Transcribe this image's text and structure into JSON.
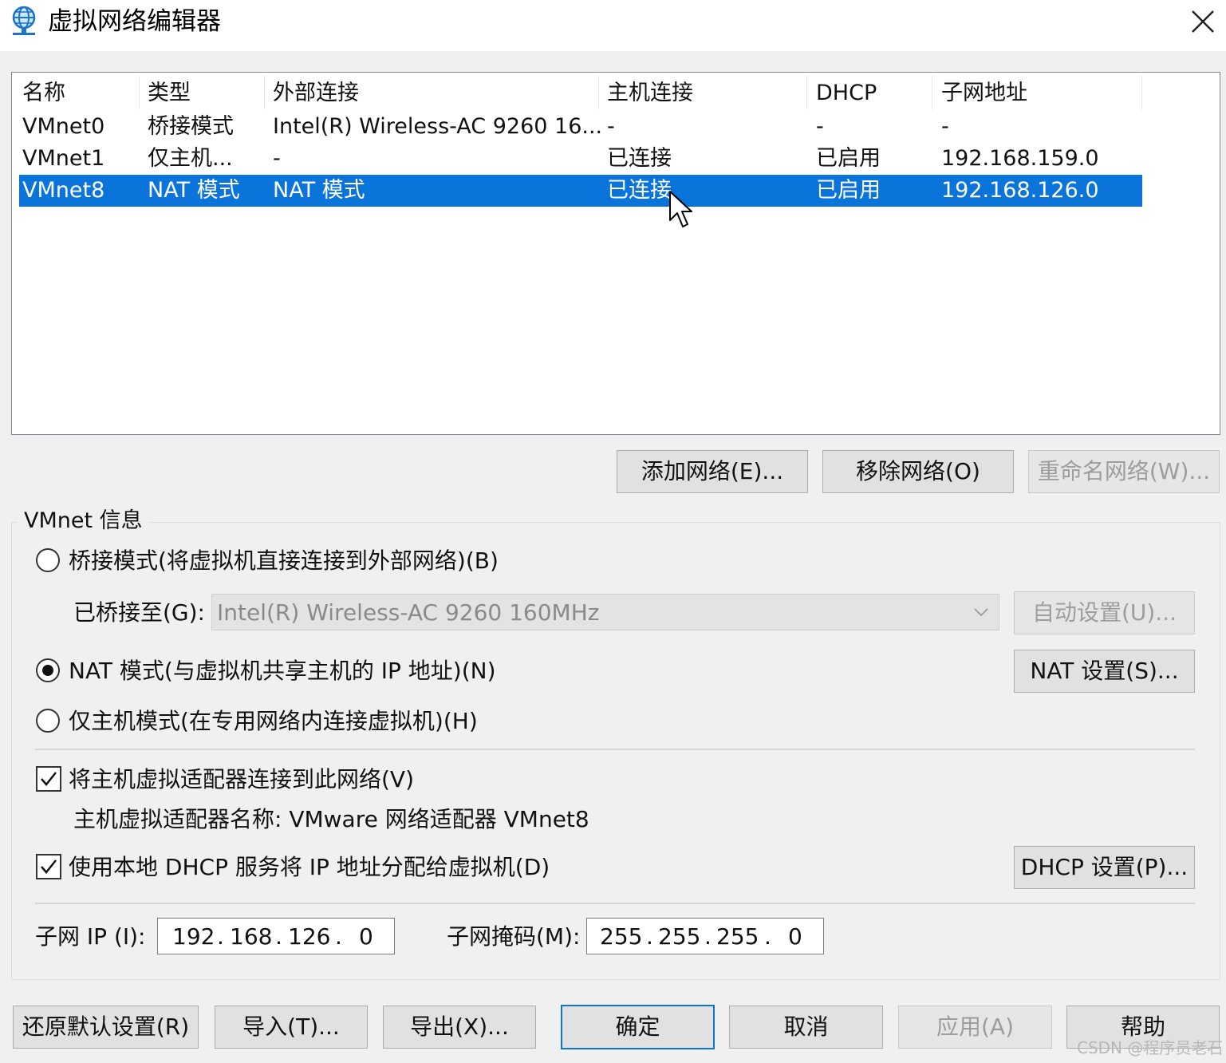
{
  "window": {
    "title": "虚拟网络编辑器",
    "icon": "globe-network-icon",
    "close_icon": "close-icon"
  },
  "table": {
    "headers": [
      "名称",
      "类型",
      "外部连接",
      "主机连接",
      "DHCP",
      "子网地址"
    ],
    "rows": [
      [
        "VMnet0",
        "桥接模式",
        "Intel(R) Wireless-AC 9260 16...",
        "-",
        "-",
        "-"
      ],
      [
        "VMnet1",
        "仅主机...",
        "-",
        "已连接",
        "已启用",
        "192.168.159.0"
      ],
      [
        "VMnet8",
        "NAT 模式",
        "NAT 模式",
        "已连接",
        "已启用",
        "192.168.126.0"
      ]
    ],
    "selected_row": "VMnet8"
  },
  "list_buttons": {
    "add": "添加网络(E)...",
    "remove": "移除网络(O)",
    "rename": "重命名网络(W)..."
  },
  "vmnet_info": {
    "legend": "VMnet 信息",
    "bridged_label": "桥接模式(将虚拟机直接连接到外部网络)(B)",
    "bridged_to_label": "已桥接至(G):",
    "bridged_to_value": "Intel(R) Wireless-AC 9260 160MHz",
    "auto_settings": "自动设置(U)...",
    "nat_label": "NAT 模式(与虚拟机共享主机的 IP 地址)(N)",
    "nat_settings": "NAT 设置(S)...",
    "hostonly_label": "仅主机模式(在专用网络内连接虚拟机)(H)",
    "selected_mode": "nat",
    "connect_adapter_label": "将主机虚拟适配器连接到此网络(V)",
    "connect_adapter_checked": true,
    "adapter_name_text": "主机虚拟适配器名称: VMware 网络适配器 VMnet8",
    "dhcp_label": "使用本地 DHCP 服务将 IP 地址分配给虚拟机(D)",
    "dhcp_checked": true,
    "dhcp_settings": "DHCP 设置(P)...",
    "subnet_ip_label": "子网 IP (I):",
    "subnet_ip": [
      "192",
      "168",
      "126",
      "0"
    ],
    "subnet_mask_label": "子网掩码(M):",
    "subnet_mask": [
      "255",
      "255",
      "255",
      "0"
    ]
  },
  "footer": {
    "restore": "还原默认设置(R)",
    "import": "导入(T)...",
    "export": "导出(X)...",
    "ok": "确定",
    "cancel": "取消",
    "apply": "应用(A)",
    "help": "帮助"
  },
  "watermark": "CSDN @程序员老石",
  "colors": {
    "selection": "#0a74da",
    "background": "#f0f0f0"
  }
}
